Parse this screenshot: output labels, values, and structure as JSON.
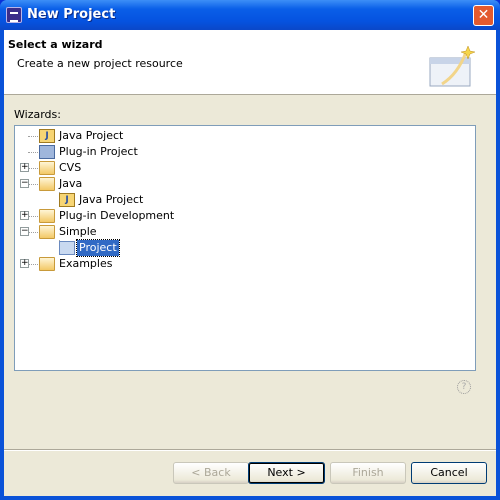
{
  "window": {
    "title": "New Project",
    "close_label": "✕"
  },
  "banner": {
    "title": "Select a wizard",
    "description": "Create a new project resource"
  },
  "wizards_label": "Wizards:",
  "tree": [
    {
      "label": "Java Project",
      "level": 0,
      "icon": "java-project-icon",
      "expander": null
    },
    {
      "label": "Plug-in Project",
      "level": 0,
      "icon": "plugin-project-icon",
      "expander": null
    },
    {
      "label": "CVS",
      "level": 0,
      "icon": "folder-icon",
      "expander": "+"
    },
    {
      "label": "Java",
      "level": 0,
      "icon": "folder-icon",
      "expander": "−"
    },
    {
      "label": "Java Project",
      "level": 1,
      "icon": "java-project-icon",
      "expander": null
    },
    {
      "label": "Plug-in Development",
      "level": 0,
      "icon": "folder-icon",
      "expander": "+"
    },
    {
      "label": "Simple",
      "level": 0,
      "icon": "folder-icon",
      "expander": "−"
    },
    {
      "label": "Project",
      "level": 1,
      "icon": "simple-project-icon",
      "expander": null,
      "selected": true
    },
    {
      "label": "Examples",
      "level": 0,
      "icon": "folder-icon",
      "expander": "+"
    }
  ],
  "help_icon": "?",
  "buttons": {
    "back": "< Back",
    "next": "Next >",
    "finish": "Finish",
    "cancel": "Cancel"
  }
}
